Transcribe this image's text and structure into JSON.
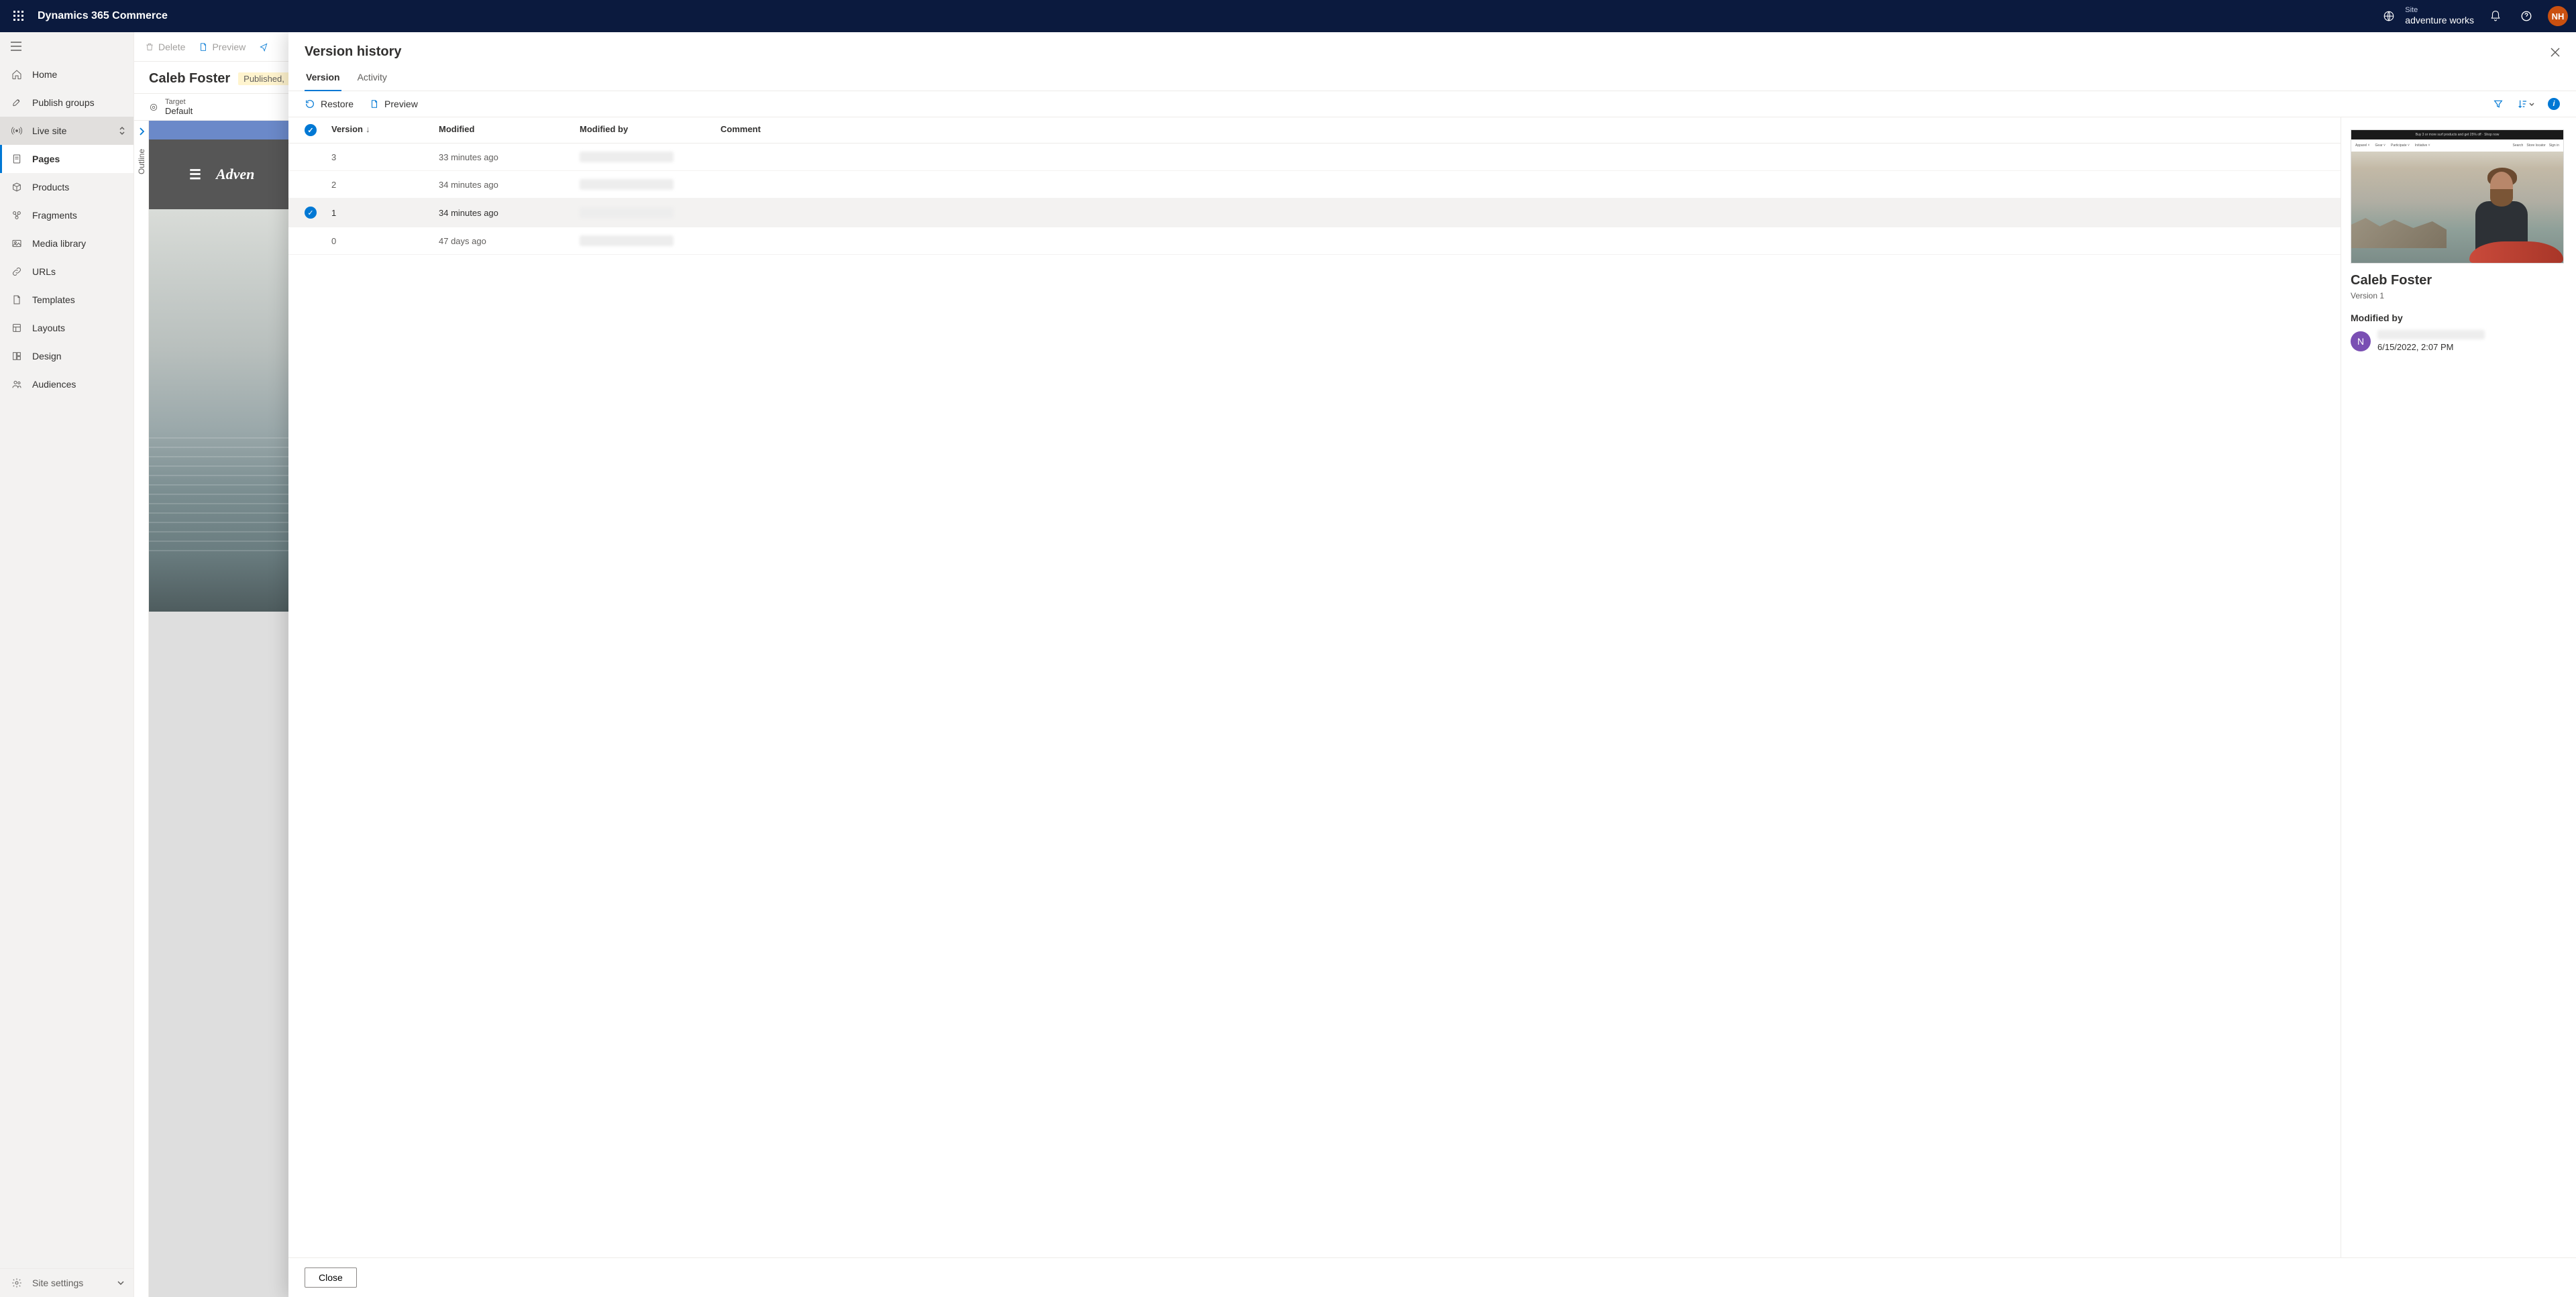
{
  "topbar": {
    "app_title": "Dynamics 365 Commerce",
    "site_label": "Site",
    "site_name": "adventure works",
    "avatar_initials": "NH"
  },
  "sidebar": {
    "items": [
      {
        "label": "Home"
      },
      {
        "label": "Publish groups"
      },
      {
        "label": "Live site"
      },
      {
        "label": "Pages"
      },
      {
        "label": "Products"
      },
      {
        "label": "Fragments"
      },
      {
        "label": "Media library"
      },
      {
        "label": "URLs"
      },
      {
        "label": "Templates"
      },
      {
        "label": "Layouts"
      },
      {
        "label": "Design"
      },
      {
        "label": "Audiences"
      }
    ],
    "settings_label": "Site settings"
  },
  "cmdbar": {
    "delete": "Delete",
    "preview": "Preview"
  },
  "page": {
    "title": "Caleb Foster",
    "status": "Published,",
    "target_label": "Target",
    "target_value": "Default",
    "outline_label": "Outline",
    "preview_logo": "Adven"
  },
  "panel": {
    "title": "Version history",
    "tabs": {
      "version": "Version",
      "activity": "Activity"
    },
    "toolbar": {
      "restore": "Restore",
      "preview": "Preview"
    },
    "columns": {
      "version": "Version",
      "modified": "Modified",
      "modified_by": "Modified by",
      "comment": "Comment"
    },
    "rows": [
      {
        "version": "3",
        "modified": "33 minutes ago",
        "selected": false
      },
      {
        "version": "2",
        "modified": "34 minutes ago",
        "selected": false
      },
      {
        "version": "1",
        "modified": "34 minutes ago",
        "selected": true
      },
      {
        "version": "0",
        "modified": "47 days ago",
        "selected": false
      }
    ],
    "detail": {
      "title": "Caleb Foster",
      "subtitle": "Version 1",
      "modified_by_label": "Modified by",
      "avatar_letter": "N",
      "date": "6/15/2022, 2:07 PM",
      "thumb_promo": "Buy 3 or more surf products and get 25% off · Shop now",
      "thumb_nav_items": [
        "Apparel",
        "Gear",
        "Participate",
        "Initiative"
      ],
      "thumb_nav_right": [
        "Search",
        "Store locator",
        "Sign in"
      ]
    },
    "close": "Close"
  }
}
